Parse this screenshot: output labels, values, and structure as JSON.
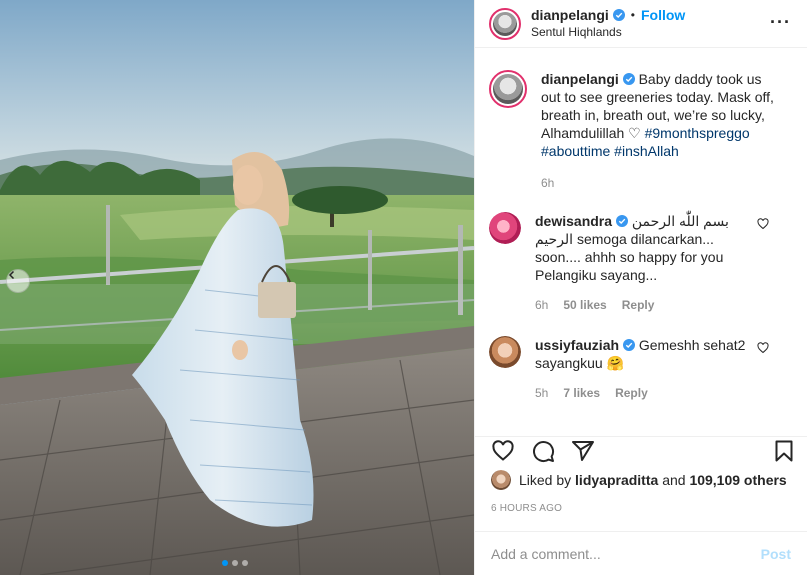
{
  "photo": {
    "dots": [
      true,
      false,
      false
    ]
  },
  "header": {
    "username": "dianpelangi",
    "separator": "•",
    "follow_label": "Follow",
    "location": "Sentul Hiqhlands",
    "more_label": "···"
  },
  "caption": {
    "username": "dianpelangi",
    "text": "Baby daddy took us out to see greeneries today. Mask off, breath in, breath out, we’re so lucky, Alhamdulillah ♡ ",
    "hashtags": [
      "#9monthspreggo",
      "#abouttime",
      "#inshAllah"
    ],
    "time": "6h"
  },
  "comments": [
    {
      "username": "dewisandra",
      "text": "بسم اللّٰه الرحمن الرحيم semoga dilancarkan... soon.... ahhh so happy for you Pelangiku sayang...",
      "time": "6h",
      "likes": "50 likes",
      "reply": "Reply"
    },
    {
      "username": "ussiyfauziah",
      "text": "Gemeshh sehat2 sayangkuu 🤗",
      "time": "5h",
      "likes": "7 likes",
      "reply": "Reply"
    }
  ],
  "likes": {
    "prefix": "Liked by",
    "user": "lidyapraditta",
    "middle": "and",
    "count": "109,109 others"
  },
  "timestamp": "6 HOURS AGO",
  "add_comment": {
    "placeholder": "Add a comment...",
    "post_label": "Post"
  },
  "colors": {
    "accent": "#0095f6",
    "hashtag": "#00376b",
    "muted": "#8e8e8e",
    "post_disabled": "#b2dffc"
  },
  "icons": {
    "verified": "verified-badge-icon",
    "like": "heart-icon",
    "comment": "comment-icon",
    "share": "share-icon",
    "save": "bookmark-icon",
    "prev": "chevron-left-icon"
  }
}
